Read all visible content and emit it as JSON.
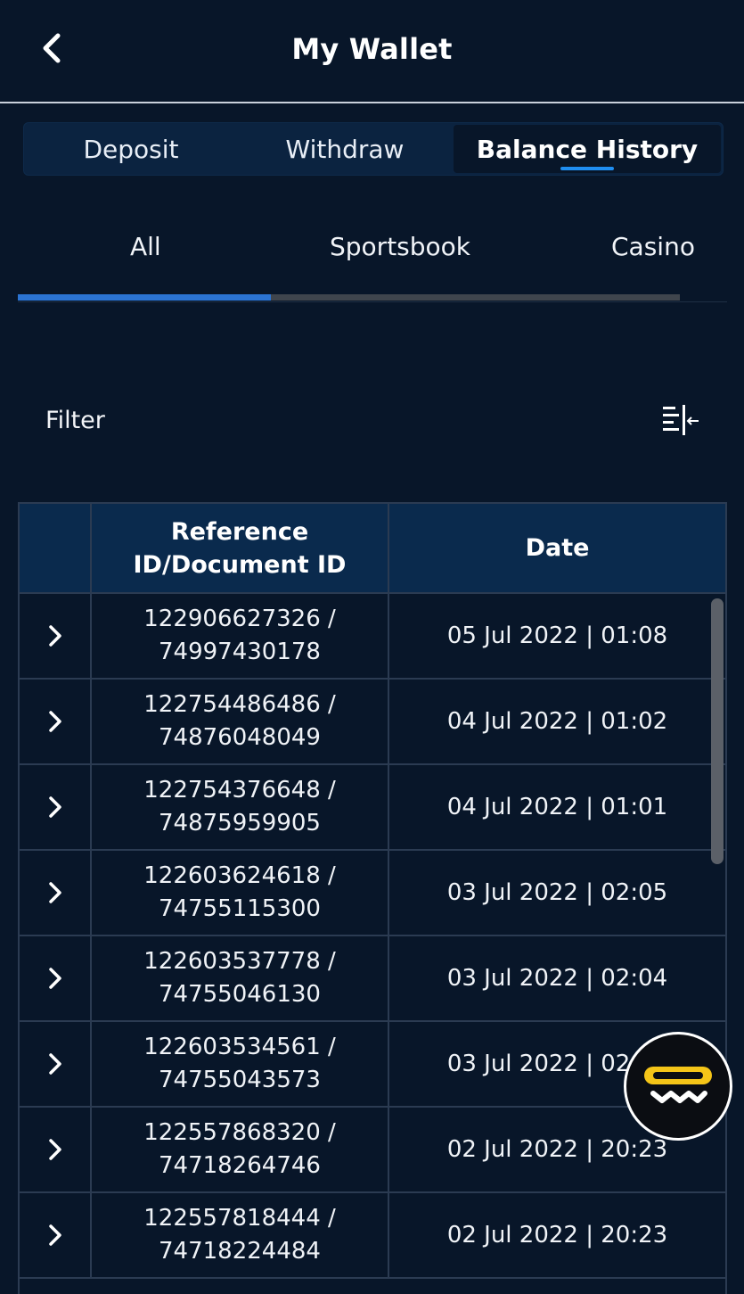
{
  "header": {
    "title": "My Wallet",
    "back_icon": "chevron-left-icon"
  },
  "main_tabs": [
    {
      "label": "Deposit",
      "active": false
    },
    {
      "label": "Withdraw",
      "active": false
    },
    {
      "label": "Balance History",
      "active": true
    }
  ],
  "sub_tabs": [
    {
      "label": "All",
      "active": true
    },
    {
      "label": "Sportsbook",
      "active": false
    },
    {
      "label": "Casino",
      "active": false
    }
  ],
  "filter": {
    "label": "Filter",
    "icon": "filter-collapse-icon"
  },
  "table": {
    "columns": [
      "",
      "Reference ID/Document ID",
      "Date"
    ],
    "column_ref_line1": "Reference",
    "column_ref_line2": "ID/Document ID",
    "rows": [
      {
        "ref": "122906627326 /",
        "doc": "74997430178",
        "date": "05 Jul 2022 | 01:08"
      },
      {
        "ref": "122754486486 /",
        "doc": "74876048049",
        "date": "04 Jul 2022 | 01:02"
      },
      {
        "ref": "122754376648 /",
        "doc": "74875959905",
        "date": "04 Jul 2022 | 01:01"
      },
      {
        "ref": "122603624618 /",
        "doc": "74755115300",
        "date": "03 Jul 2022 | 02:05"
      },
      {
        "ref": "122603537778 /",
        "doc": "74755046130",
        "date": "03 Jul 2022 | 02:04"
      },
      {
        "ref": "122603534561 /",
        "doc": "74755043573",
        "date": "03 Jul 2022 | 02:04"
      },
      {
        "ref": "122557868320 /",
        "doc": "74718264746",
        "date": "02 Jul 2022 | 20:23"
      },
      {
        "ref": "122557818444 /",
        "doc": "74718224484",
        "date": "02 Jul 2022 | 20:23"
      }
    ]
  },
  "colors": {
    "background": "#081629",
    "accent": "#1f8ef1",
    "indicator": "#2b74d3",
    "table_header": "#0a2a4d",
    "fab_yellow": "#f5c518"
  },
  "fab": {
    "icon": "chat-support-icon"
  }
}
